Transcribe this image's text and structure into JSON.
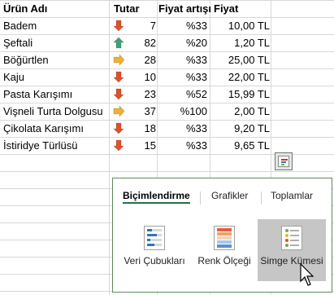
{
  "table": {
    "headers": [
      "Ürün Adı",
      "Tutar",
      "Fiyat artışı",
      "Fiyat"
    ],
    "rows": [
      {
        "name": "Badem",
        "trend": "down",
        "tutar": "7",
        "pct": "%33",
        "fiyat": "10,00 TL"
      },
      {
        "name": "Şeftali",
        "trend": "up",
        "tutar": "82",
        "pct": "%20",
        "fiyat": "1,20 TL"
      },
      {
        "name": "Böğürtlen",
        "trend": "right",
        "tutar": "28",
        "pct": "%33",
        "fiyat": "25,00 TL"
      },
      {
        "name": "Kaju",
        "trend": "down",
        "tutar": "10",
        "pct": "%33",
        "fiyat": "22,00 TL"
      },
      {
        "name": "Pasta Karışımı",
        "trend": "down",
        "tutar": "23",
        "pct": "%52",
        "fiyat": "15,99 TL"
      },
      {
        "name": "Vişneli Turta Dolgusu",
        "trend": "right",
        "tutar": "37",
        "pct": "%100",
        "fiyat": "2,00 TL"
      },
      {
        "name": "Çikolata Karışımı",
        "trend": "down",
        "tutar": "18",
        "pct": "%33",
        "fiyat": "9,20 TL"
      },
      {
        "name": "İstiridye Türlüsü",
        "trend": "down",
        "tutar": "15",
        "pct": "%33",
        "fiyat": "9,65 TL"
      }
    ]
  },
  "colors": {
    "down": "#e0502a",
    "up": "#3fa17a",
    "right": "#f0b030",
    "accent": "#217346"
  },
  "panel": {
    "tabs": [
      "Biçimlendirme",
      "Grafikler",
      "Toplamlar"
    ],
    "options": [
      {
        "label": "Veri Çubukları",
        "icon": "data-bars-icon"
      },
      {
        "label": "Renk Ölçeği",
        "icon": "color-scale-icon"
      },
      {
        "label": "Simge Kümesi",
        "icon": "icon-set-icon"
      }
    ]
  }
}
